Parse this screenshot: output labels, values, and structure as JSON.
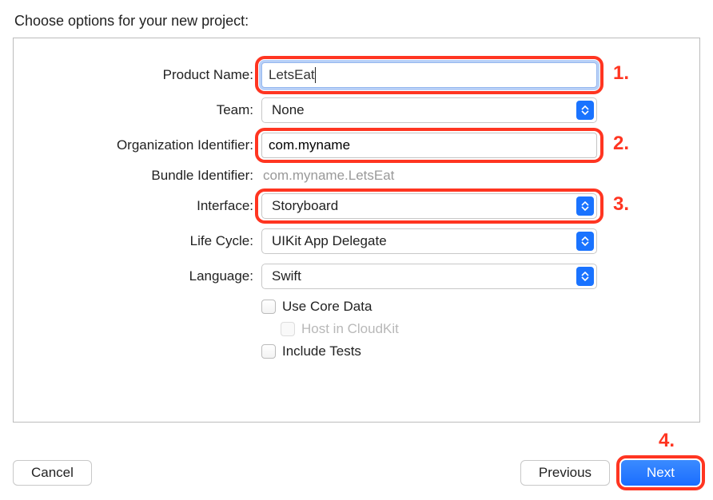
{
  "header": "Choose options for your new project:",
  "form": {
    "productName": {
      "label": "Product Name:",
      "value": "LetsEat"
    },
    "team": {
      "label": "Team:",
      "value": "None"
    },
    "orgIdentifier": {
      "label": "Organization Identifier:",
      "value": "com.myname"
    },
    "bundleIdentifier": {
      "label": "Bundle Identifier:",
      "value": "com.myname.LetsEat"
    },
    "interface": {
      "label": "Interface:",
      "value": "Storyboard"
    },
    "lifeCycle": {
      "label": "Life Cycle:",
      "value": "UIKit App Delegate"
    },
    "language": {
      "label": "Language:",
      "value": "Swift"
    },
    "useCoreData": {
      "label": "Use Core Data"
    },
    "hostCloudKit": {
      "label": "Host in CloudKit"
    },
    "includeTests": {
      "label": "Include Tests"
    }
  },
  "annotations": {
    "a1": "1.",
    "a2": "2.",
    "a3": "3.",
    "a4": "4."
  },
  "buttons": {
    "cancel": "Cancel",
    "previous": "Previous",
    "next": "Next"
  }
}
